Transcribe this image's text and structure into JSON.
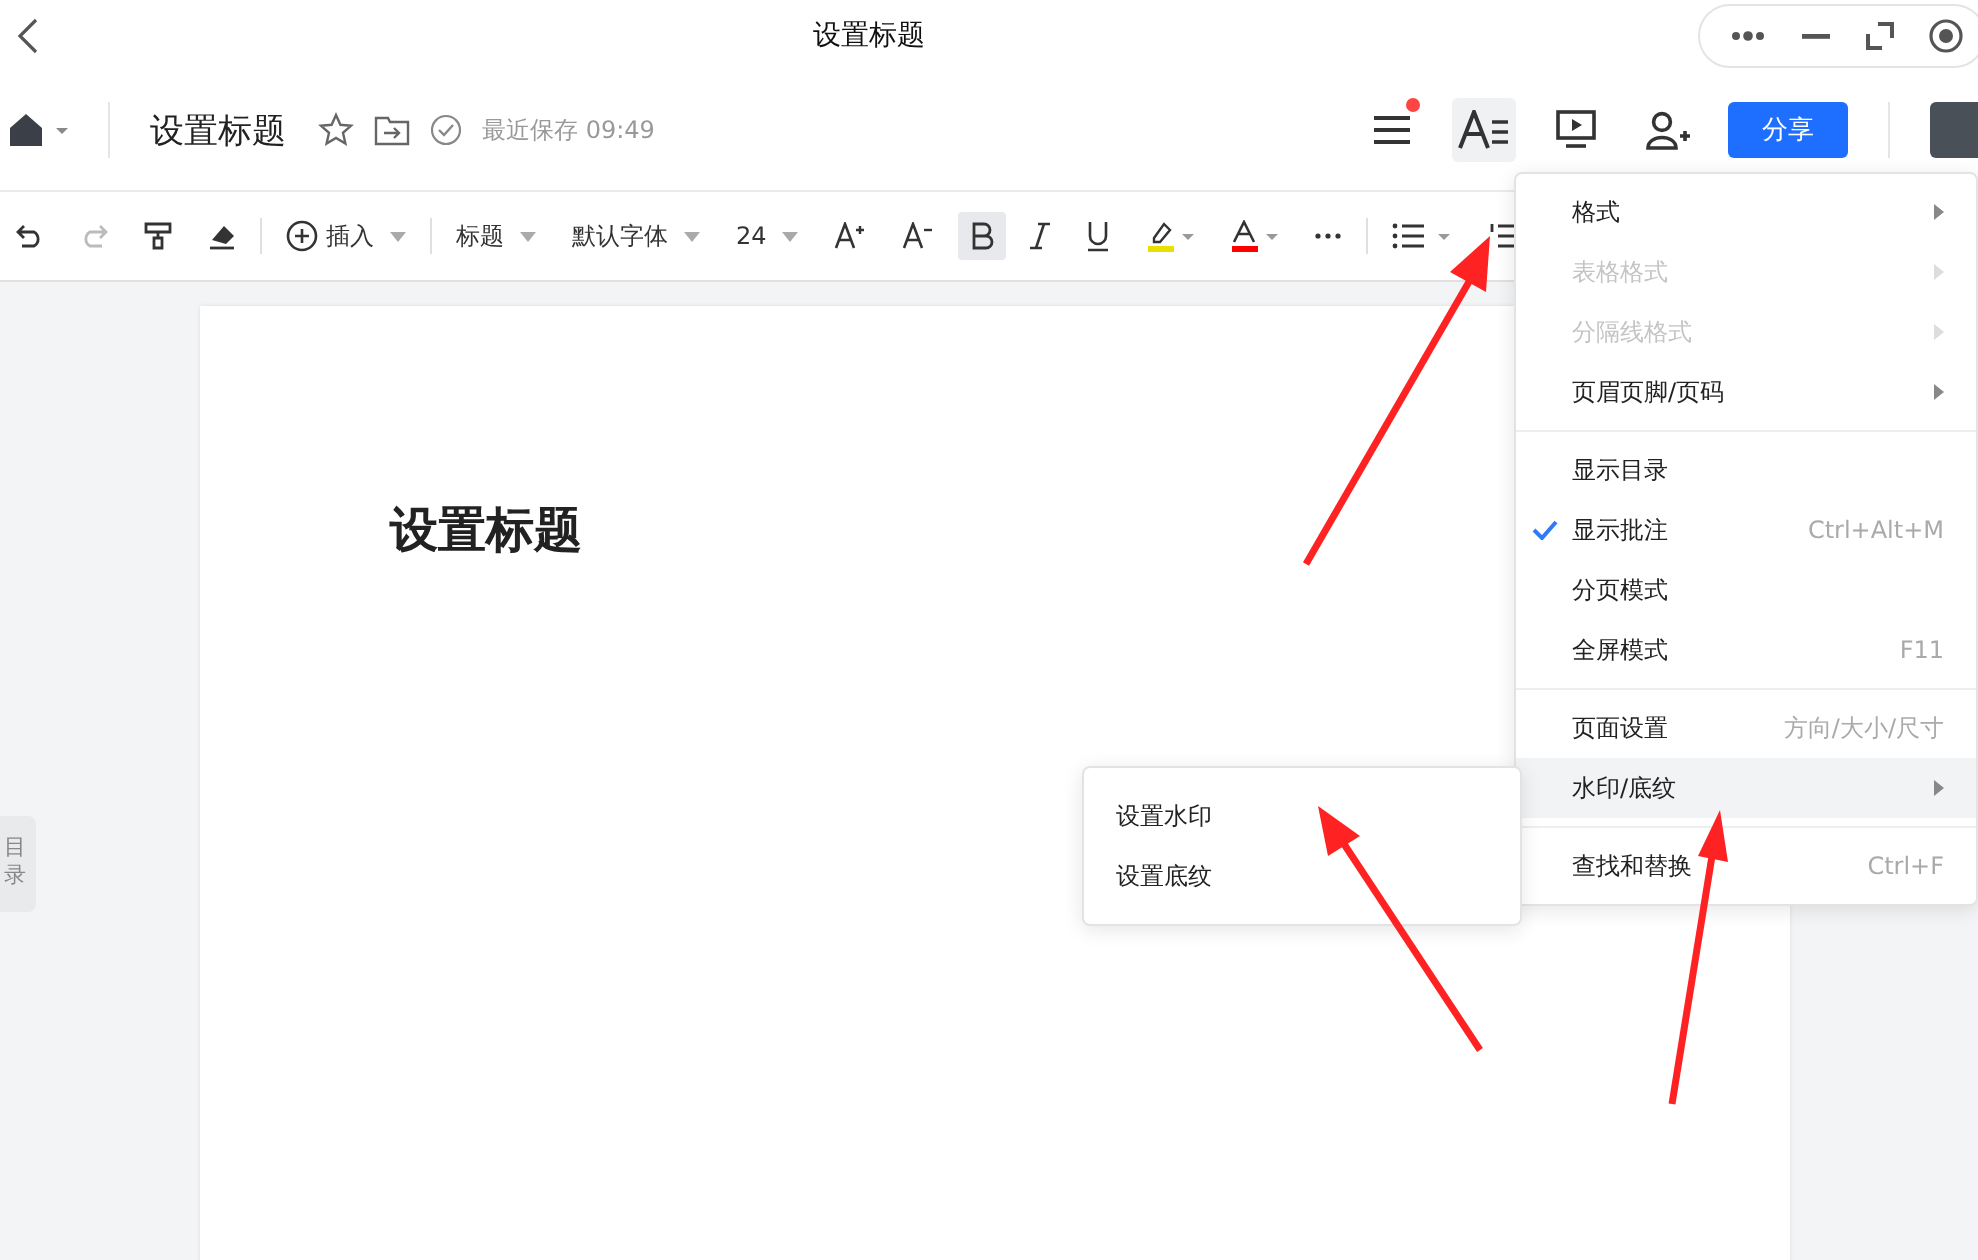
{
  "window": {
    "title": "设置标题"
  },
  "header": {
    "document_title": "设置标题",
    "starred": false,
    "save_status": "最近保存 09:49",
    "menu_notification": true,
    "share_button": "分享"
  },
  "toolbar": {
    "insert": "插入",
    "paragraph_style": "标题",
    "font": "默认字体",
    "font_size": "24",
    "bold_active": true
  },
  "document": {
    "heading": "设置标题"
  },
  "side_tab": {
    "label": "目录"
  },
  "menu": {
    "groups": [
      {
        "items": [
          {
            "label": "格式",
            "disabled": false,
            "submenu": true,
            "checked": false,
            "selected": false
          },
          {
            "label": "表格格式",
            "disabled": true,
            "submenu": true,
            "checked": false,
            "selected": false
          },
          {
            "label": "分隔线格式",
            "disabled": true,
            "submenu": true,
            "checked": false,
            "selected": false
          },
          {
            "label": "页眉页脚/页码",
            "disabled": false,
            "submenu": true,
            "checked": false,
            "selected": false
          }
        ]
      },
      {
        "items": [
          {
            "label": "显示目录",
            "disabled": false,
            "submenu": false,
            "checked": false,
            "selected": false
          },
          {
            "label": "显示批注",
            "shortcut": "Ctrl+Alt+M",
            "disabled": false,
            "submenu": false,
            "checked": true,
            "selected": false
          },
          {
            "label": "分页模式",
            "disabled": false,
            "submenu": false,
            "checked": false,
            "selected": false
          },
          {
            "label": "全屏模式",
            "shortcut": "F11",
            "disabled": false,
            "submenu": false,
            "checked": false,
            "selected": false
          }
        ]
      },
      {
        "items": [
          {
            "label": "页面设置",
            "shortcut": "方向/大小/尺寸",
            "disabled": false,
            "submenu": false,
            "checked": false,
            "selected": false
          },
          {
            "label": "水印/底纹",
            "disabled": false,
            "submenu": true,
            "checked": false,
            "selected": true
          }
        ]
      },
      {
        "items": [
          {
            "label": "查找和替换",
            "shortcut": "Ctrl+F",
            "disabled": false,
            "submenu": false,
            "checked": false,
            "selected": false
          }
        ]
      }
    ]
  },
  "submenu": {
    "items": [
      {
        "label": "设置水印"
      },
      {
        "label": "设置底纹"
      }
    ]
  }
}
